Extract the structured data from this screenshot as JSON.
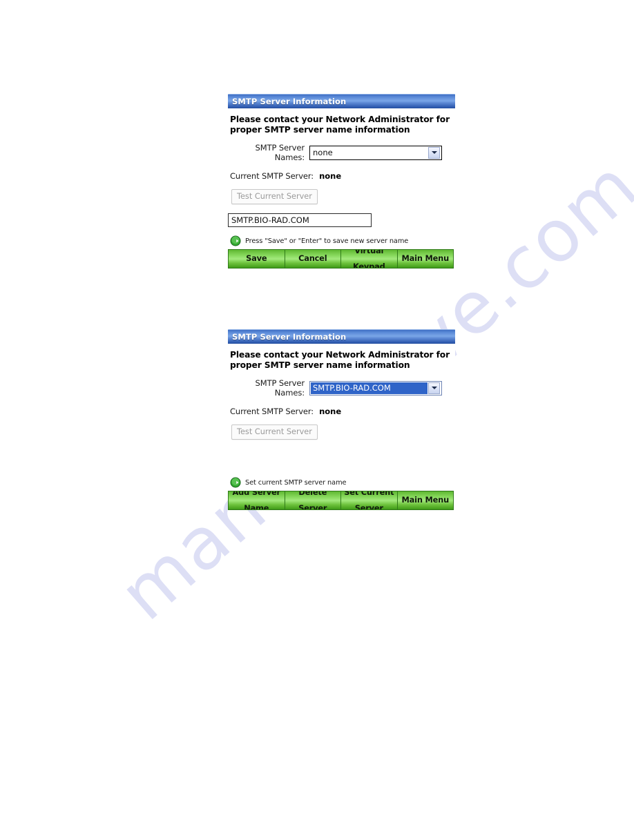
{
  "watermark": {
    "text": "manualshive.com"
  },
  "panels": [
    {
      "title": "SMTP Server Information",
      "instructions_line1": "Please contact your Network Administrator for",
      "instructions_line2": "proper SMTP server name information",
      "server_names_label": "SMTP Server Names:",
      "server_names_value": "none",
      "server_names_selected": false,
      "current_label": "Current SMTP Server:",
      "current_value": "none",
      "test_button_label": "Test Current Server",
      "text_input_value": "SMTP.BIO-RAD.COM",
      "hint_icon": "green-arrow-icon",
      "hint_text": "Press \"Save\" or \"Enter\" to save new server name",
      "buttons": [
        {
          "line1": "Save",
          "line2": ""
        },
        {
          "line1": "Cancel",
          "line2": ""
        },
        {
          "line1": "Virtual",
          "line2": "Keypad"
        },
        {
          "line1": "Main Menu",
          "line2": ""
        }
      ]
    },
    {
      "title": "SMTP Server Information",
      "instructions_line1": "Please contact your Network Administrator for",
      "instructions_line2": "proper SMTP server name information",
      "server_names_label": "SMTP Server Names:",
      "server_names_value": "SMTP.BIO-RAD.COM",
      "server_names_selected": true,
      "current_label": "Current SMTP Server:",
      "current_value": "none",
      "test_button_label": "Test Current Server",
      "hint_icon": "green-arrow-icon",
      "hint_text": "Set current SMTP server name",
      "buttons": [
        {
          "line1": "Add Server",
          "line2": "Name"
        },
        {
          "line1": "Delete",
          "line2": "Server"
        },
        {
          "line1": "Set Current",
          "line2": "Server"
        },
        {
          "line1": "Main Menu",
          "line2": ""
        }
      ]
    }
  ],
  "colors": {
    "titlebar_blue": "#3f6fc4",
    "button_green": "#6dc23c",
    "selection_blue": "#2f64c8",
    "watermark_lavender": "#c9cdf0"
  }
}
